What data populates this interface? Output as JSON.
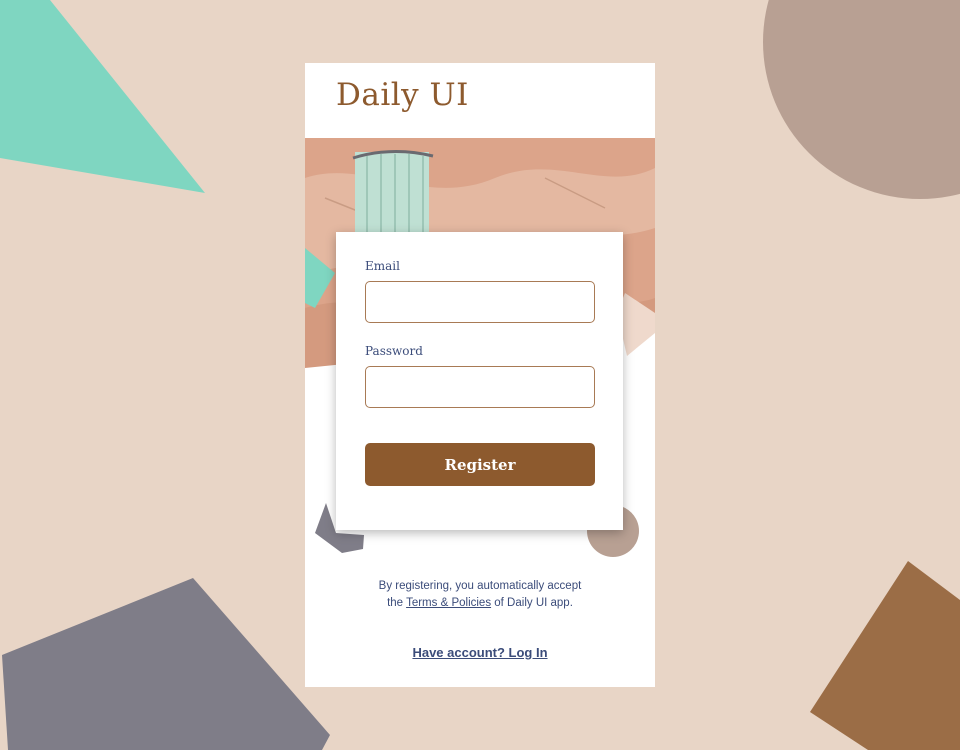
{
  "app": {
    "logo": "Daily UI"
  },
  "form": {
    "email_label": "Email",
    "email_value": "",
    "password_label": "Password",
    "password_value": "",
    "register_label": "Register"
  },
  "terms": {
    "line1": "By registering, you automatically accept",
    "prefix": "the ",
    "link": "Terms & Policies",
    "suffix": " of Daily UI app."
  },
  "login": {
    "label": "Have account? Log In"
  },
  "colors": {
    "background": "#e8d5c6",
    "accent_brown": "#8d5a2e",
    "text_navy": "#3b4c7a",
    "teal": "#7fd6c1",
    "mauve": "#b8a093",
    "slate": "#7f7d88",
    "tan": "#9b6d46"
  }
}
